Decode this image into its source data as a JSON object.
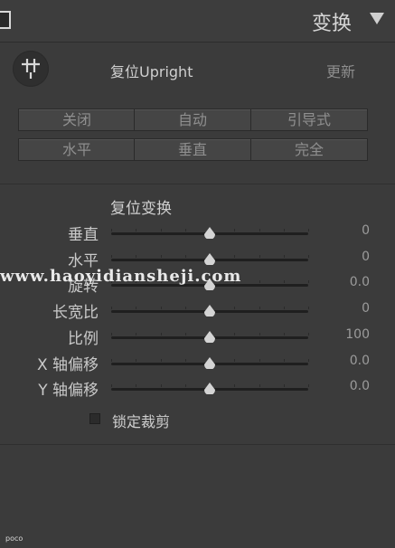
{
  "header": {
    "title": "变换"
  },
  "upright": {
    "icon": "crop-upright-icon",
    "reset_label": "复位Upright",
    "update_label": "更新",
    "buttons_row1": [
      "关闭",
      "自动",
      "引导式"
    ],
    "buttons_row2": [
      "水平",
      "垂直",
      "完全"
    ]
  },
  "transform": {
    "section_title": "复位变换",
    "sliders": [
      {
        "label": "垂直",
        "value": "0",
        "position": 0.5
      },
      {
        "label": "水平",
        "value": "0",
        "position": 0.5
      },
      {
        "label": "旋转",
        "value": "0.0",
        "position": 0.5
      },
      {
        "label": "长宽比",
        "value": "0",
        "position": 0.5
      },
      {
        "label": "比例",
        "value": "100",
        "position": 0.5
      },
      {
        "label": "X 轴偏移",
        "value": "0.0",
        "position": 0.5
      },
      {
        "label": "Y 轴偏移",
        "value": "0.0",
        "position": 0.5
      }
    ],
    "lock_crop_label": "锁定裁剪",
    "lock_crop_checked": false
  },
  "watermark": {
    "text": "www.haoyidiansheji.com"
  },
  "footer": {
    "badge": "poco"
  },
  "colors": {
    "panel": "#3b3b3b",
    "text": "#c9c9c9",
    "button": "#454545"
  }
}
